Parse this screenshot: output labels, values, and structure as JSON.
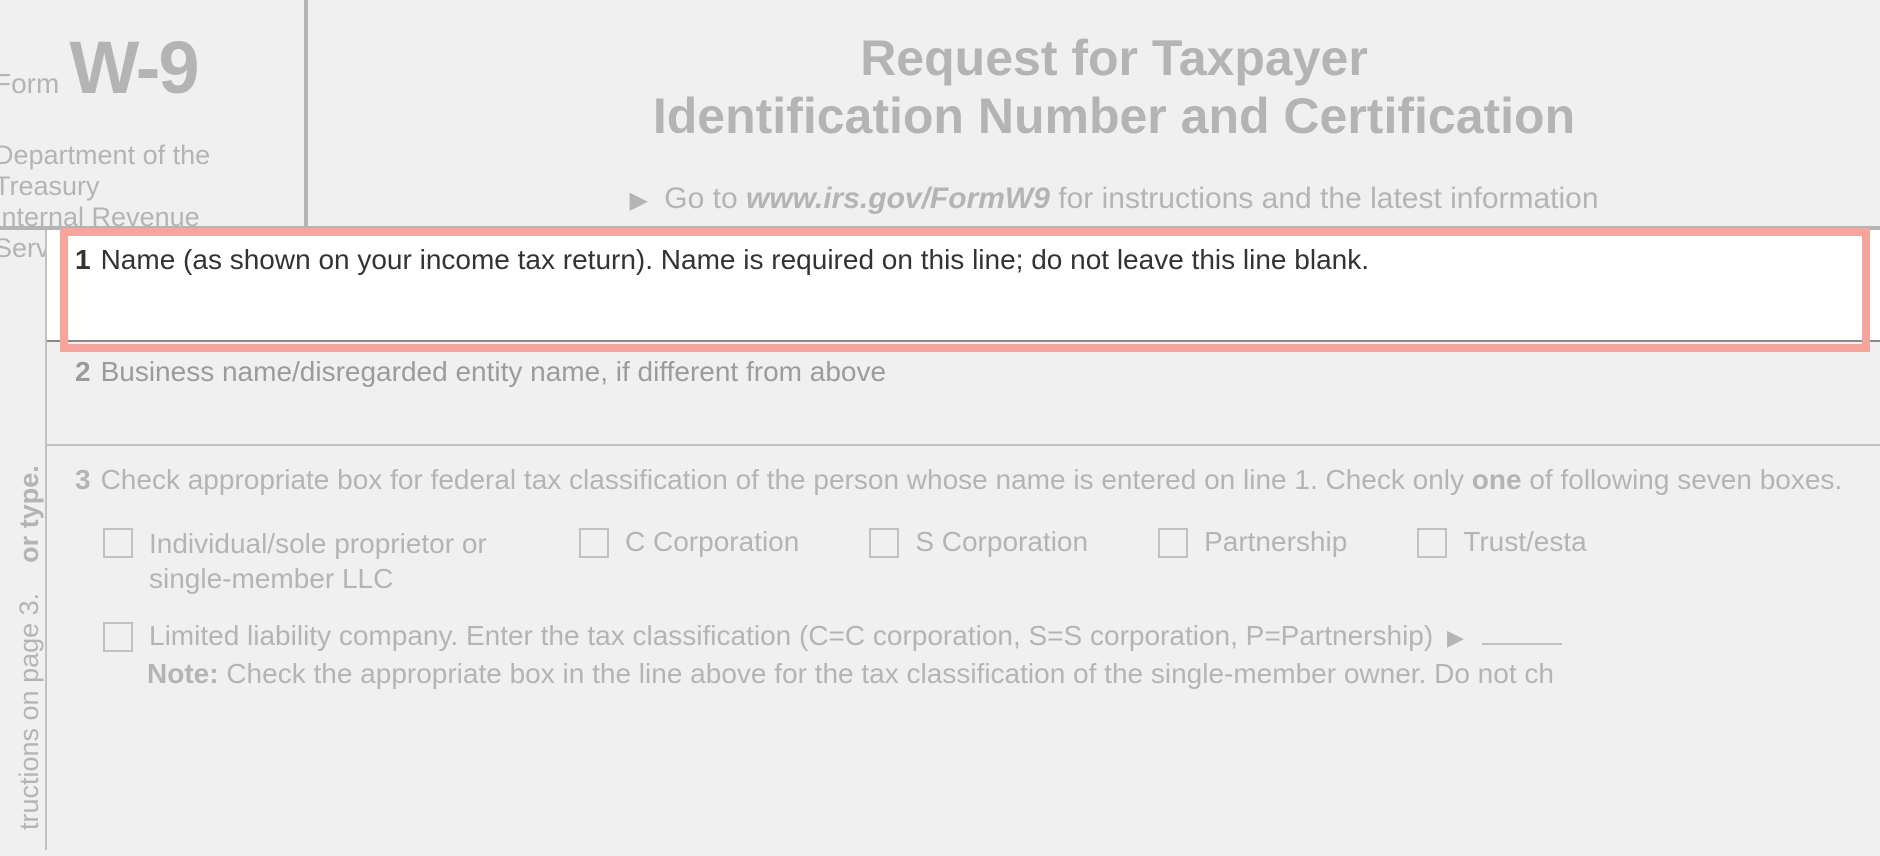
{
  "header": {
    "form_label": "Form",
    "form_name": "W-9",
    "dept_line1": "Department of the Treasury",
    "dept_line2": "Internal Revenue Service",
    "title_line1": "Request for Taxpayer",
    "title_line2": "Identification Number and Certification",
    "goto_prefix": "Go to ",
    "goto_url": "www.irs.gov/FormW9",
    "goto_suffix": " for instructions and the latest information"
  },
  "side": {
    "text1": "or type.",
    "text2": "tructions on page 3."
  },
  "fields": {
    "line1": {
      "num": "1",
      "text": "Name (as shown on your income tax return). Name is required on this line; do not leave this line blank."
    },
    "line2": {
      "num": "2",
      "text": "Business name/disregarded entity name, if different from above"
    },
    "line3": {
      "num": "3",
      "text_pre": "Check appropriate box for federal tax classification of the person whose name is entered on line 1. Check only ",
      "one": "one",
      "text_post": " of following seven boxes."
    }
  },
  "checkboxes": {
    "individual": "Individual/sole proprietor or single-member LLC",
    "c_corp": "C Corporation",
    "s_corp": "S Corporation",
    "partnership": "Partnership",
    "trust": "Trust/esta"
  },
  "llc": {
    "text": "Limited liability company. Enter the tax classification (C=C corporation, S=S corporation, P=Partnership)",
    "note_label": "Note:",
    "note_text": " Check the appropriate box in the line above for the tax classification of the single-member owner.  Do not ch"
  }
}
